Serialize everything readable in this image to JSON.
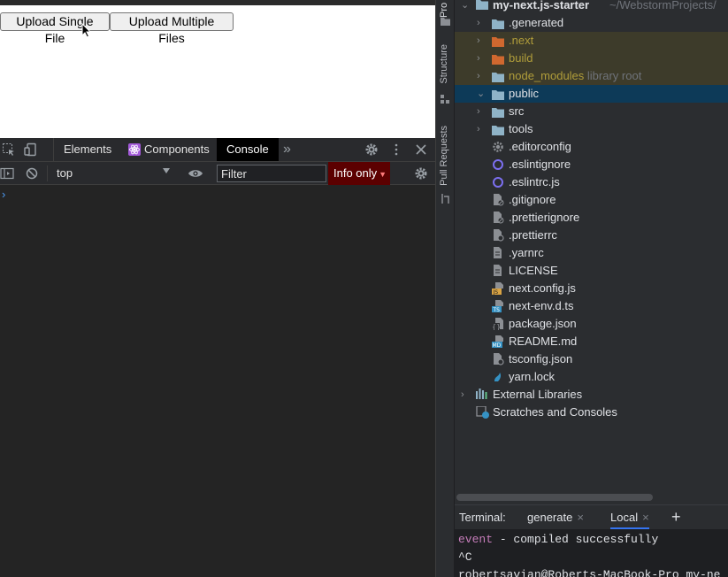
{
  "page": {
    "upload_single": "Upload Single File",
    "upload_multiple": "Upload Multiple Files"
  },
  "devtools": {
    "tabs": [
      "Elements",
      "Components",
      "Console"
    ],
    "active_tab": "Console",
    "more": "»",
    "context": "top",
    "filter_placeholder": "Filter",
    "levels": "Info only",
    "prompt": "›"
  },
  "ide": {
    "side_tabs": [
      "Pro",
      "Structure",
      "Pull Requests"
    ],
    "project": {
      "root": "my-next.js-starter",
      "root_path": "~/WebstormProjects/",
      "items": [
        {
          "label": ".generated",
          "kind": "folder",
          "color": "#8fb3c7",
          "expandable": true
        },
        {
          "label": ".next",
          "kind": "folder",
          "color": "#d0682f",
          "expandable": true,
          "excluded": true
        },
        {
          "label": "build",
          "kind": "folder",
          "color": "#d0682f",
          "expandable": true,
          "excluded": true
        },
        {
          "label": "node_modules",
          "hint": "library root",
          "kind": "folder",
          "color": "#8fb3c7",
          "expandable": true,
          "excluded": true
        },
        {
          "label": "public",
          "kind": "folder",
          "color": "#8fb3c7",
          "expandable": true,
          "selected": true
        },
        {
          "label": "src",
          "kind": "folder",
          "color": "#8fb3c7",
          "expandable": true
        },
        {
          "label": "tools",
          "kind": "folder",
          "color": "#8fb3c7",
          "expandable": true
        },
        {
          "label": ".editorconfig",
          "kind": "gear-file"
        },
        {
          "label": ".eslintignore",
          "kind": "eslint-file"
        },
        {
          "label": ".eslintrc.js",
          "kind": "eslint-file"
        },
        {
          "label": ".gitignore",
          "kind": "ignore-file"
        },
        {
          "label": ".prettierignore",
          "kind": "ignore-file"
        },
        {
          "label": ".prettierrc",
          "kind": "config-file"
        },
        {
          "label": ".yarnrc",
          "kind": "text-file"
        },
        {
          "label": "LICENSE",
          "kind": "text-file"
        },
        {
          "label": "next.config.js",
          "kind": "js-file"
        },
        {
          "label": "next-env.d.ts",
          "kind": "ts-file"
        },
        {
          "label": "package.json",
          "kind": "json-file"
        },
        {
          "label": "README.md",
          "kind": "md-file"
        },
        {
          "label": "tsconfig.json",
          "kind": "config-file"
        },
        {
          "label": "yarn.lock",
          "kind": "yarn-file"
        }
      ],
      "external_libraries": "External Libraries",
      "scratches": "Scratches and Consoles"
    },
    "terminal": {
      "label": "Terminal:",
      "tabs": [
        "generate",
        "Local"
      ],
      "active_tab": "Local",
      "add": "+",
      "lines": [
        {
          "kw": "event",
          "text": " - compiled successfully"
        },
        {
          "kw": "",
          "text": "^C"
        },
        {
          "kw": "",
          "text": "robertsavian@Roberts-MacBook-Pro my-ne"
        }
      ]
    }
  }
}
